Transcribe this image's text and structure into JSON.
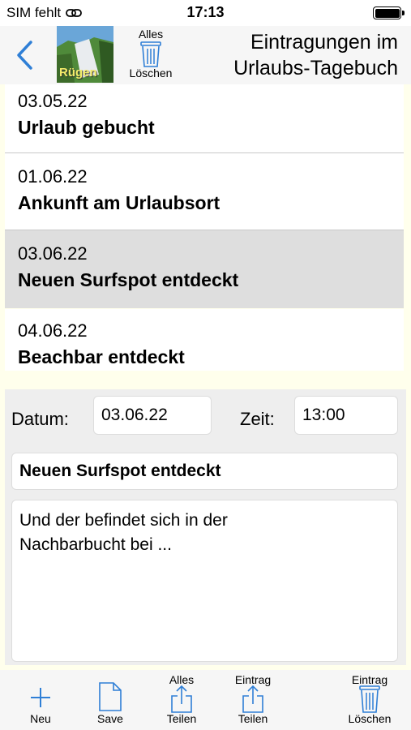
{
  "status": {
    "carrier": "SIM fehlt",
    "time": "17:13"
  },
  "nav": {
    "thumbnail_label": "Rügen",
    "clear_all_line1": "Alles",
    "clear_all_line2": "Löschen",
    "title_line1": "Eintragungen im",
    "title_line2": "Urlaubs-Tagebuch"
  },
  "entries": [
    {
      "date": "03.05.22",
      "title": "Urlaub gebucht"
    },
    {
      "date": "01.06.22",
      "title": "Ankunft am Urlaubsort"
    },
    {
      "date": "03.06.22",
      "title": "Neuen Surfspot entdeckt"
    },
    {
      "date": "04.06.22",
      "title": "Beachbar entdeckt"
    }
  ],
  "selected_index": 2,
  "detail": {
    "date_label": "Datum:",
    "date_value": "03.06.22",
    "time_label": "Zeit:",
    "time_value": "13:00",
    "title_value": "Neuen Surfspot entdeckt",
    "note_value": "Und der befindet sich in der\nNachbarbucht bei ..."
  },
  "toolbar": {
    "new_label": "Neu",
    "save_label": "Save",
    "share_all_top": "Alles",
    "share_all_bottom": "Teilen",
    "share_entry_top": "Eintrag",
    "share_entry_bottom": "Teilen",
    "delete_entry_top": "Eintrag",
    "delete_entry_bottom": "Löschen"
  },
  "colors": {
    "accent": "#2f7fd6",
    "list_background": "#ffffec",
    "selected_row": "#dedede",
    "panel_background": "#eeeeee"
  },
  "icons": [
    "link-icon",
    "battery-icon",
    "back-chevron-icon",
    "trash-icon",
    "plus-icon",
    "document-icon",
    "share-icon"
  ]
}
